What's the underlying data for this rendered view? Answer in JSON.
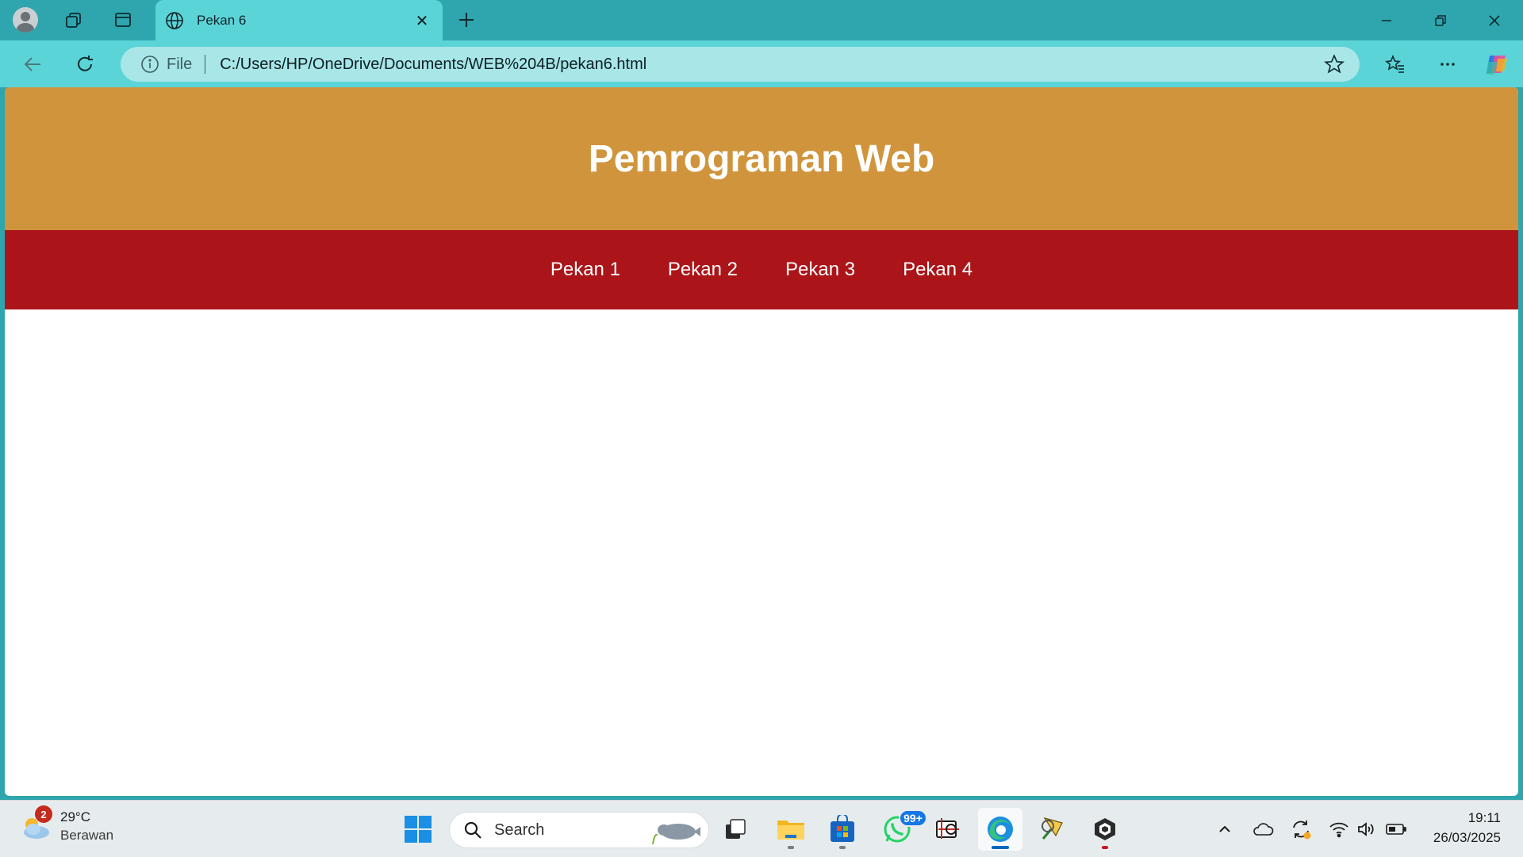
{
  "browser": {
    "tab": {
      "title": "Pekan 6"
    },
    "address": {
      "scheme_label": "File",
      "url": "C:/Users/HP/OneDrive/Documents/WEB%204B/pekan6.html"
    }
  },
  "page": {
    "title": "Pemrograman Web",
    "nav": [
      "Pekan 1",
      "Pekan 2",
      "Pekan 3",
      "Pekan 4"
    ],
    "colors": {
      "header_bg": "#d0943c",
      "nav_bg": "#ab1519",
      "text": "#ffffff"
    }
  },
  "taskbar": {
    "weather": {
      "temp": "29°C",
      "desc": "Berawan",
      "badge": "2"
    },
    "search_placeholder": "Search",
    "whatsapp_badge": "99+",
    "clock": {
      "time": "19:11",
      "date": "26/03/2025"
    }
  }
}
